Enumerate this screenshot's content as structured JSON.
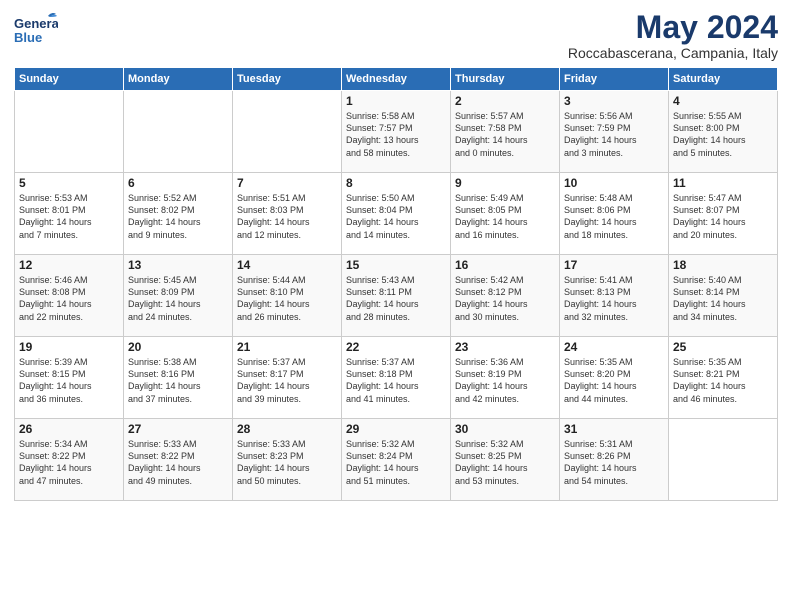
{
  "header": {
    "logo_general": "General",
    "logo_blue": "Blue",
    "month": "May 2024",
    "location": "Roccabascerana, Campania, Italy"
  },
  "days_of_week": [
    "Sunday",
    "Monday",
    "Tuesday",
    "Wednesday",
    "Thursday",
    "Friday",
    "Saturday"
  ],
  "weeks": [
    [
      {
        "day": "",
        "content": ""
      },
      {
        "day": "",
        "content": ""
      },
      {
        "day": "",
        "content": ""
      },
      {
        "day": "1",
        "content": "Sunrise: 5:58 AM\nSunset: 7:57 PM\nDaylight: 13 hours\nand 58 minutes."
      },
      {
        "day": "2",
        "content": "Sunrise: 5:57 AM\nSunset: 7:58 PM\nDaylight: 14 hours\nand 0 minutes."
      },
      {
        "day": "3",
        "content": "Sunrise: 5:56 AM\nSunset: 7:59 PM\nDaylight: 14 hours\nand 3 minutes."
      },
      {
        "day": "4",
        "content": "Sunrise: 5:55 AM\nSunset: 8:00 PM\nDaylight: 14 hours\nand 5 minutes."
      }
    ],
    [
      {
        "day": "5",
        "content": "Sunrise: 5:53 AM\nSunset: 8:01 PM\nDaylight: 14 hours\nand 7 minutes."
      },
      {
        "day": "6",
        "content": "Sunrise: 5:52 AM\nSunset: 8:02 PM\nDaylight: 14 hours\nand 9 minutes."
      },
      {
        "day": "7",
        "content": "Sunrise: 5:51 AM\nSunset: 8:03 PM\nDaylight: 14 hours\nand 12 minutes."
      },
      {
        "day": "8",
        "content": "Sunrise: 5:50 AM\nSunset: 8:04 PM\nDaylight: 14 hours\nand 14 minutes."
      },
      {
        "day": "9",
        "content": "Sunrise: 5:49 AM\nSunset: 8:05 PM\nDaylight: 14 hours\nand 16 minutes."
      },
      {
        "day": "10",
        "content": "Sunrise: 5:48 AM\nSunset: 8:06 PM\nDaylight: 14 hours\nand 18 minutes."
      },
      {
        "day": "11",
        "content": "Sunrise: 5:47 AM\nSunset: 8:07 PM\nDaylight: 14 hours\nand 20 minutes."
      }
    ],
    [
      {
        "day": "12",
        "content": "Sunrise: 5:46 AM\nSunset: 8:08 PM\nDaylight: 14 hours\nand 22 minutes."
      },
      {
        "day": "13",
        "content": "Sunrise: 5:45 AM\nSunset: 8:09 PM\nDaylight: 14 hours\nand 24 minutes."
      },
      {
        "day": "14",
        "content": "Sunrise: 5:44 AM\nSunset: 8:10 PM\nDaylight: 14 hours\nand 26 minutes."
      },
      {
        "day": "15",
        "content": "Sunrise: 5:43 AM\nSunset: 8:11 PM\nDaylight: 14 hours\nand 28 minutes."
      },
      {
        "day": "16",
        "content": "Sunrise: 5:42 AM\nSunset: 8:12 PM\nDaylight: 14 hours\nand 30 minutes."
      },
      {
        "day": "17",
        "content": "Sunrise: 5:41 AM\nSunset: 8:13 PM\nDaylight: 14 hours\nand 32 minutes."
      },
      {
        "day": "18",
        "content": "Sunrise: 5:40 AM\nSunset: 8:14 PM\nDaylight: 14 hours\nand 34 minutes."
      }
    ],
    [
      {
        "day": "19",
        "content": "Sunrise: 5:39 AM\nSunset: 8:15 PM\nDaylight: 14 hours\nand 36 minutes."
      },
      {
        "day": "20",
        "content": "Sunrise: 5:38 AM\nSunset: 8:16 PM\nDaylight: 14 hours\nand 37 minutes."
      },
      {
        "day": "21",
        "content": "Sunrise: 5:37 AM\nSunset: 8:17 PM\nDaylight: 14 hours\nand 39 minutes."
      },
      {
        "day": "22",
        "content": "Sunrise: 5:37 AM\nSunset: 8:18 PM\nDaylight: 14 hours\nand 41 minutes."
      },
      {
        "day": "23",
        "content": "Sunrise: 5:36 AM\nSunset: 8:19 PM\nDaylight: 14 hours\nand 42 minutes."
      },
      {
        "day": "24",
        "content": "Sunrise: 5:35 AM\nSunset: 8:20 PM\nDaylight: 14 hours\nand 44 minutes."
      },
      {
        "day": "25",
        "content": "Sunrise: 5:35 AM\nSunset: 8:21 PM\nDaylight: 14 hours\nand 46 minutes."
      }
    ],
    [
      {
        "day": "26",
        "content": "Sunrise: 5:34 AM\nSunset: 8:22 PM\nDaylight: 14 hours\nand 47 minutes."
      },
      {
        "day": "27",
        "content": "Sunrise: 5:33 AM\nSunset: 8:22 PM\nDaylight: 14 hours\nand 49 minutes."
      },
      {
        "day": "28",
        "content": "Sunrise: 5:33 AM\nSunset: 8:23 PM\nDaylight: 14 hours\nand 50 minutes."
      },
      {
        "day": "29",
        "content": "Sunrise: 5:32 AM\nSunset: 8:24 PM\nDaylight: 14 hours\nand 51 minutes."
      },
      {
        "day": "30",
        "content": "Sunrise: 5:32 AM\nSunset: 8:25 PM\nDaylight: 14 hours\nand 53 minutes."
      },
      {
        "day": "31",
        "content": "Sunrise: 5:31 AM\nSunset: 8:26 PM\nDaylight: 14 hours\nand 54 minutes."
      },
      {
        "day": "",
        "content": ""
      }
    ]
  ]
}
